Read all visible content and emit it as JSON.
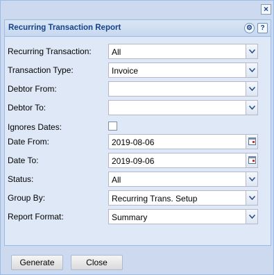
{
  "window": {
    "close_glyph": "×"
  },
  "panel": {
    "title": "Recurring Transaction Report",
    "gear_glyph": "⚙",
    "help_glyph": "?"
  },
  "form": {
    "recurring_transaction": {
      "label": "Recurring Transaction:",
      "value": "All"
    },
    "transaction_type": {
      "label": "Transaction Type:",
      "value": "Invoice"
    },
    "debtor_from": {
      "label": "Debtor From:",
      "value": ""
    },
    "debtor_to": {
      "label": "Debtor To:",
      "value": ""
    },
    "ignores_dates": {
      "label": "Ignores Dates:",
      "checked": false
    },
    "date_from": {
      "label": "Date From:",
      "value": "2019-08-06"
    },
    "date_to": {
      "label": "Date To:",
      "value": "2019-09-06"
    },
    "status": {
      "label": "Status:",
      "value": "All"
    },
    "group_by": {
      "label": "Group By:",
      "value": "Recurring Trans. Setup"
    },
    "report_format": {
      "label": "Report Format:",
      "value": "Summary"
    }
  },
  "buttons": {
    "generate": "Generate",
    "close": "Close"
  },
  "icons": {
    "dropdown": "chevron-down-icon",
    "date": "calendar-icon",
    "settings": "gear-icon",
    "help": "help-icon",
    "close": "close-icon"
  },
  "colors": {
    "title": "#15428b",
    "window_bg": "#ccd9ee",
    "panel_bg": "#dfe8f6",
    "border": "#99bbe8"
  }
}
